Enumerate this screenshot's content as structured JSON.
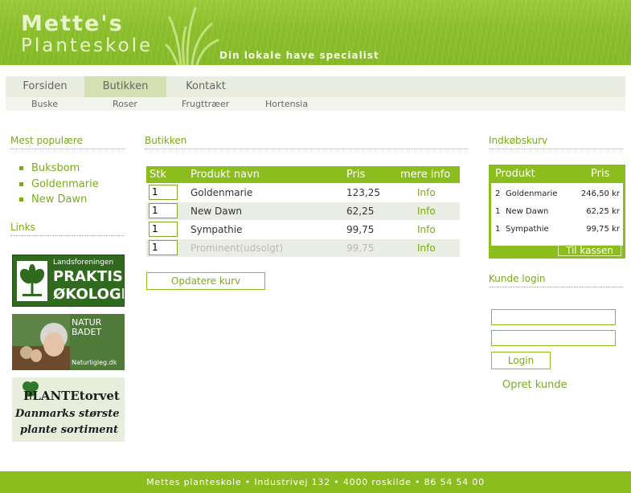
{
  "header": {
    "logo_line1": "Mette's",
    "logo_line2": "Planteskole",
    "slogan": "Din lokale have specialist"
  },
  "nav": {
    "items": [
      {
        "label": "Forsiden",
        "active": false
      },
      {
        "label": "Butikken",
        "active": true
      },
      {
        "label": "Kontakt",
        "active": false
      }
    ],
    "subitems": [
      "Buske",
      "Roser",
      "Frugttræer",
      "Hortensia"
    ]
  },
  "left": {
    "popular_heading": "Mest populære",
    "popular": [
      "Buksbom",
      "Goldenmarie",
      "New Dawn"
    ],
    "links_heading": "Links",
    "banners": [
      {
        "line1": "Landsforeningen",
        "line2": "PRAKTISK",
        "line3": "ØKOLOGI"
      },
      {
        "line1": "NATUR",
        "line2": "BADET",
        "line3": "Naturligleg.dk"
      },
      {
        "line1": "PLANTEtorvet",
        "line2": "Danmarks største",
        "line3": "plante sortiment"
      }
    ]
  },
  "main": {
    "heading": "Butikken",
    "table_headers": {
      "qty": "Stk",
      "name": "Produkt navn",
      "price": "Pris",
      "info": "mere info"
    },
    "rows": [
      {
        "qty": "1",
        "name": "Goldenmarie",
        "price": "123,25",
        "info": "Info",
        "sold_out": false
      },
      {
        "qty": "1",
        "name": "New Dawn",
        "price": "62,25",
        "info": "Info",
        "sold_out": false
      },
      {
        "qty": "1",
        "name": "Sympathie",
        "price": "99,75",
        "info": "Info",
        "sold_out": false
      },
      {
        "qty": "1",
        "name": "Prominent(udsolgt)",
        "price": "99,75",
        "info": "Info",
        "sold_out": true
      }
    ],
    "update_button": "Opdatere kurv"
  },
  "cart": {
    "heading": "Indkøbskurv",
    "col_product": "Produkt",
    "col_price": "Pris",
    "items": [
      {
        "qty": "2",
        "name": "Goldenmarie",
        "price": "246,50 kr"
      },
      {
        "qty": "1",
        "name": "New Dawn",
        "price": "62,25 kr"
      },
      {
        "qty": "1",
        "name": "Sympathie",
        "price": "99,75 kr"
      }
    ],
    "checkout_button": "Til kassen"
  },
  "login": {
    "heading": "Kunde login",
    "username_value": "",
    "password_value": "",
    "login_button": "Login",
    "create_link": "Opret kunde"
  },
  "footer": {
    "text": "Mettes planteskole • Industrivej 132 • 4000 roskilde • 86 54 54 00"
  },
  "colors": {
    "brand_green": "#8cbd1f",
    "link_green": "#7aaa1a"
  }
}
